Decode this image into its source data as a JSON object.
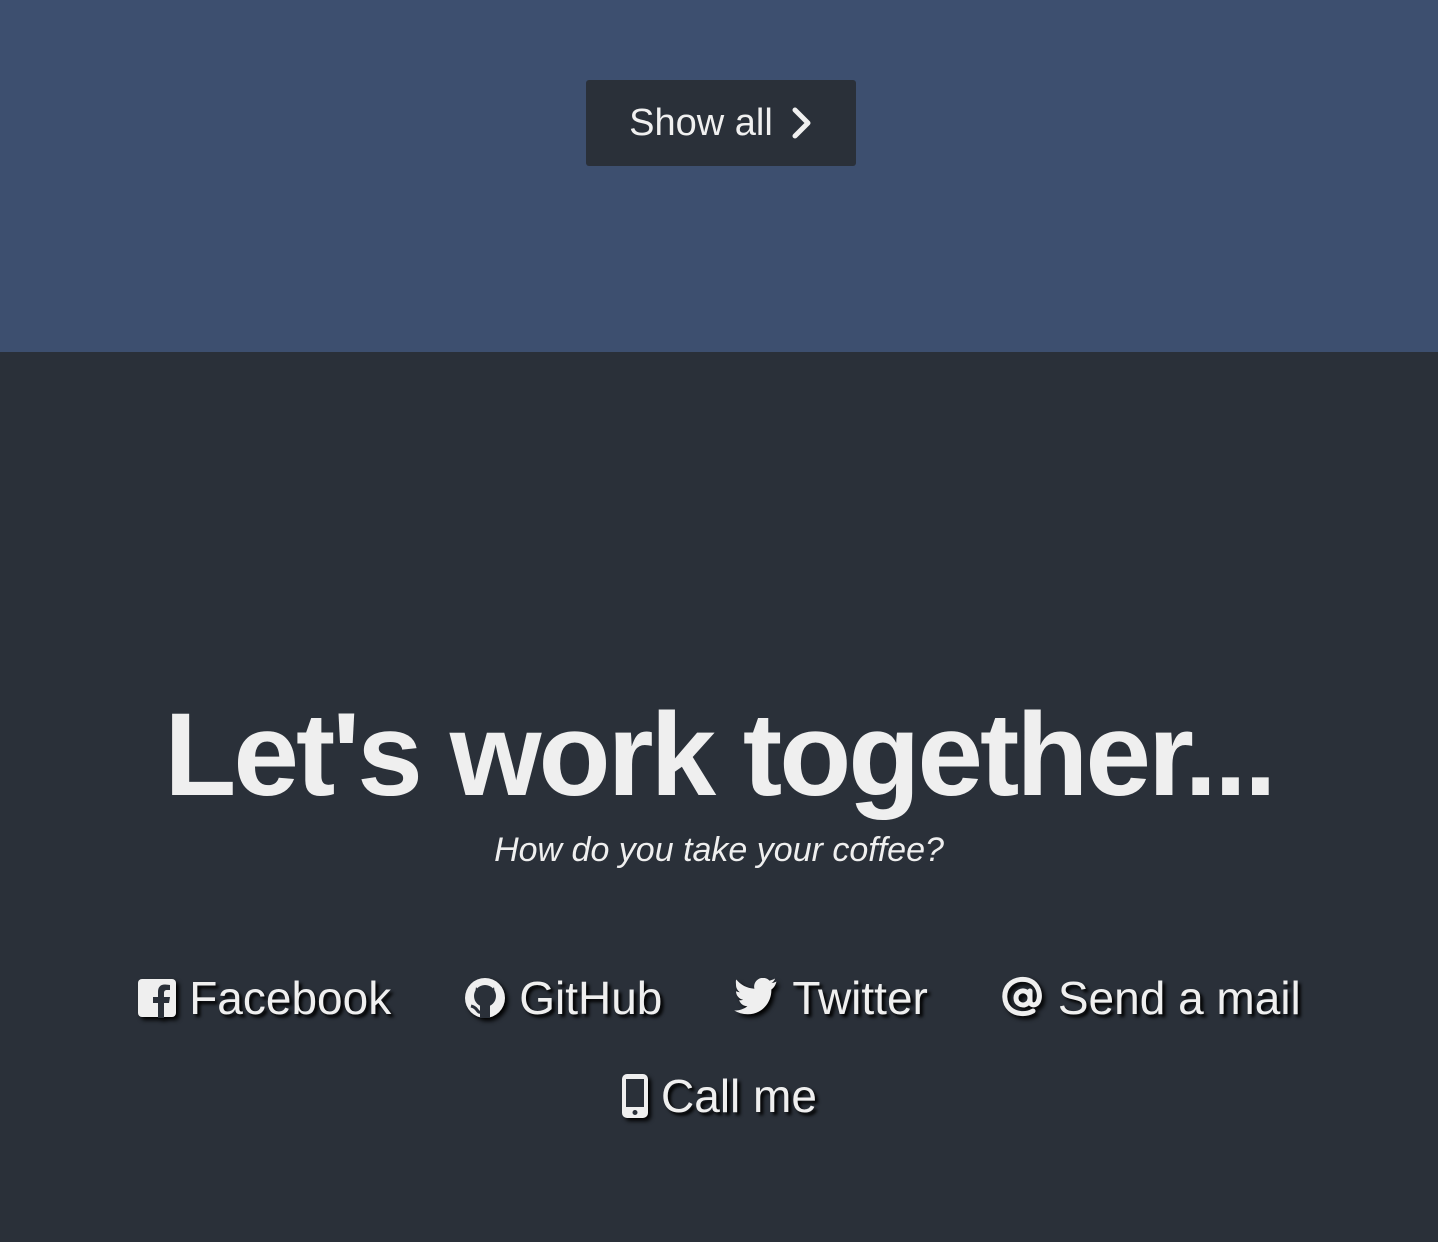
{
  "top_section": {
    "background_color": "#3d4f6f",
    "show_all_button": {
      "label": "Show all",
      "icon": "chevron-right-icon"
    }
  },
  "contact_section": {
    "background_color": "#2a3039",
    "headline": "Let's work together...",
    "subtitle": "How do you take your coffee?",
    "links": [
      {
        "label": "Facebook",
        "icon": "facebook-icon"
      },
      {
        "label": "GitHub",
        "icon": "github-icon"
      },
      {
        "label": "Twitter",
        "icon": "twitter-icon"
      },
      {
        "label": "Send a mail",
        "icon": "at-sign-icon"
      },
      {
        "label": "Call me",
        "icon": "mobile-phone-icon"
      }
    ]
  }
}
